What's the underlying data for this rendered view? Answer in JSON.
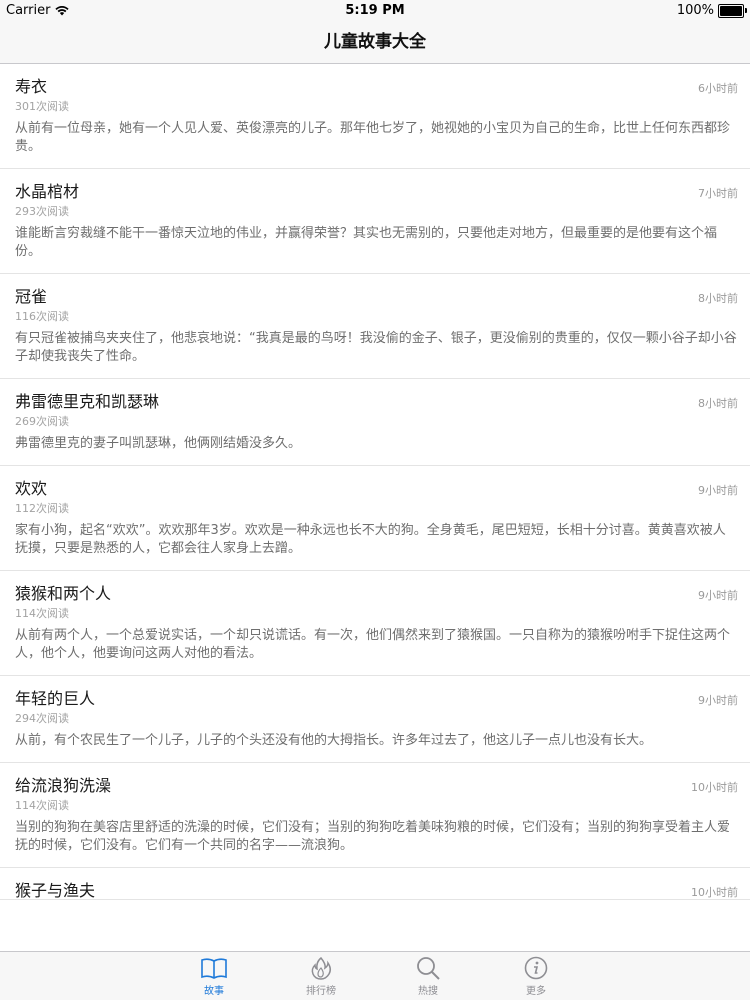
{
  "status_bar": {
    "carrier": "Carrier",
    "time": "5:19 PM",
    "battery": "100%",
    "battery_level": 1.0
  },
  "nav": {
    "title": "儿童故事大全"
  },
  "stories": [
    {
      "title": "寿衣",
      "time": "6小时前",
      "reads": "301次阅读",
      "summary": "从前有一位母亲，她有一个人见人爱、英俊漂亮的儿子。那年他七岁了，她视她的小宝贝为自己的生命，比世上任何东西都珍贵。"
    },
    {
      "title": "水晶棺材",
      "time": "7小时前",
      "reads": "293次阅读",
      "summary": "谁能断言穷裁缝不能干一番惊天泣地的伟业，并赢得荣誉？其实也无需别的，只要他走对地方，但最重要的是他要有这个福份。"
    },
    {
      "title": "冠雀",
      "time": "8小时前",
      "reads": "116次阅读",
      "summary": "有只冠雀被捕鸟夹夹住了，他悲哀地说：“我真是最的鸟呀！我没偷的金子、银子，更没偷别的贵重的，仅仅一颗小谷子却小谷子却使我丧失了性命。"
    },
    {
      "title": "弗雷德里克和凯瑟琳",
      "time": "8小时前",
      "reads": "269次阅读",
      "summary": "弗雷德里克的妻子叫凯瑟琳，他俩刚结婚没多久。"
    },
    {
      "title": "欢欢",
      "time": "9小时前",
      "reads": "112次阅读",
      "summary": "家有小狗，起名“欢欢”。欢欢那年3岁。欢欢是一种永远也长不大的狗。全身黄毛，尾巴短短，长相十分讨喜。黄黄喜欢被人抚摸，只要是熟悉的人，它都会往人家身上去蹭。"
    },
    {
      "title": "猿猴和两个人",
      "time": "9小时前",
      "reads": "114次阅读",
      "summary": "从前有两个人，一个总爱说实话，一个却只说谎话。有一次，他们偶然来到了猿猴国。一只自称为的猿猴吩咐手下捉住这两个人，他个人，他要询问这两人对他的看法。"
    },
    {
      "title": "年轻的巨人",
      "time": "9小时前",
      "reads": "294次阅读",
      "summary": "从前，有个农民生了一个儿子，儿子的个头还没有他的大拇指长。许多年过去了，他这儿子一点儿也没有长大。"
    },
    {
      "title": "给流浪狗洗澡",
      "time": "10小时前",
      "reads": "114次阅读",
      "summary": "当别的狗狗在美容店里舒适的洗澡的时候，它们没有；当别的狗狗吃着美味狗粮的时候，它们没有；当别的狗狗享受着主人爱抚的时候，它们没有。它们有一个共同的名字——流浪狗。"
    },
    {
      "title": "猴子与渔夫",
      "time": "10小时前",
      "reads": "",
      "summary": ""
    }
  ],
  "tabs": [
    {
      "label": "故事",
      "icon": "book-icon",
      "active": true
    },
    {
      "label": "排行榜",
      "icon": "flame-icon",
      "active": false
    },
    {
      "label": "热搜",
      "icon": "search-icon",
      "active": false
    },
    {
      "label": "更多",
      "icon": "info-icon",
      "active": false
    }
  ],
  "colors": {
    "accent": "#1f7ad9",
    "inactive": "#8e8e93"
  }
}
